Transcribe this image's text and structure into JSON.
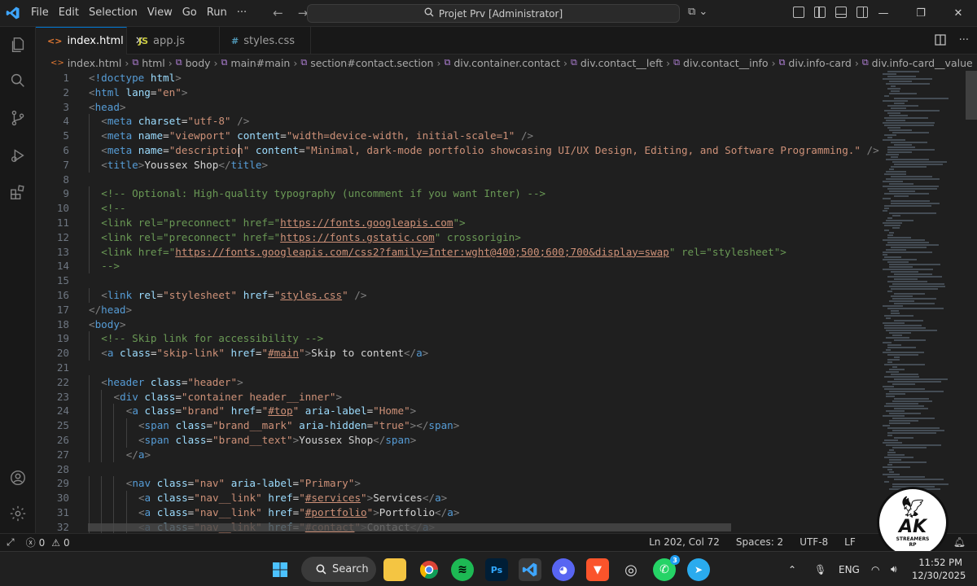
{
  "titlebar": {
    "menu": [
      "File",
      "Edit",
      "Selection",
      "View",
      "Go",
      "Run",
      "···"
    ],
    "command_center": "Projet Prv [Administrator]"
  },
  "tabs": [
    {
      "label": "index.html",
      "icon": "html-icon",
      "active": true
    },
    {
      "label": "app.js",
      "icon": "js-icon",
      "active": false
    },
    {
      "label": "styles.css",
      "icon": "css-icon",
      "active": false
    }
  ],
  "breadcrumb": [
    "index.html",
    "html",
    "body",
    "main#main",
    "section#contact.section",
    "div.container.contact",
    "div.contact__left",
    "div.contact__info",
    "div.info-card",
    "div.info-card__value"
  ],
  "editor": {
    "lines": [
      {
        "n": "1",
        "indent": 0,
        "tokens": [
          [
            "punc",
            "<"
          ],
          [
            "tag",
            "!doctype"
          ],
          [
            "txt",
            " "
          ],
          [
            "attr",
            "html"
          ],
          [
            "punc",
            ">"
          ]
        ]
      },
      {
        "n": "2",
        "indent": 0,
        "tokens": [
          [
            "punc",
            "<"
          ],
          [
            "tag",
            "html"
          ],
          [
            "txt",
            " "
          ],
          [
            "attr",
            "lang"
          ],
          [
            "txt",
            "="
          ],
          [
            "str",
            "\"en\""
          ],
          [
            "punc",
            ">"
          ]
        ]
      },
      {
        "n": "3",
        "indent": 0,
        "tokens": [
          [
            "punc",
            "<"
          ],
          [
            "tag",
            "head"
          ],
          [
            "punc",
            ">"
          ]
        ]
      },
      {
        "n": "4",
        "indent": 1,
        "tokens": [
          [
            "punc",
            "<"
          ],
          [
            "tag",
            "meta"
          ],
          [
            "txt",
            " "
          ],
          [
            "attr",
            "charset"
          ],
          [
            "txt",
            "="
          ],
          [
            "str",
            "\"utf-8\""
          ],
          [
            "txt",
            " "
          ],
          [
            "punc",
            "/>"
          ]
        ]
      },
      {
        "n": "5",
        "indent": 1,
        "tokens": [
          [
            "punc",
            "<"
          ],
          [
            "tag",
            "meta"
          ],
          [
            "txt",
            " "
          ],
          [
            "attr",
            "name"
          ],
          [
            "txt",
            "="
          ],
          [
            "str",
            "\"viewport\""
          ],
          [
            "txt",
            " "
          ],
          [
            "attr",
            "content"
          ],
          [
            "txt",
            "="
          ],
          [
            "str",
            "\"width=device-width, initial-scale=1\""
          ],
          [
            "txt",
            " "
          ],
          [
            "punc",
            "/>"
          ]
        ]
      },
      {
        "n": "6",
        "indent": 1,
        "tokens": [
          [
            "punc",
            "<"
          ],
          [
            "tag",
            "meta"
          ],
          [
            "txt",
            " "
          ],
          [
            "attr",
            "name"
          ],
          [
            "txt",
            "="
          ],
          [
            "str",
            "\"description\""
          ],
          [
            "txt",
            " "
          ],
          [
            "attr",
            "content"
          ],
          [
            "txt",
            "="
          ],
          [
            "str",
            "\"Minimal, dark-mode portfolio showcasing UI/UX Design, Editing, and Software Programming.\""
          ],
          [
            "txt",
            " "
          ],
          [
            "punc",
            "/>"
          ]
        ]
      },
      {
        "n": "7",
        "indent": 1,
        "tokens": [
          [
            "punc",
            "<"
          ],
          [
            "tag",
            "title"
          ],
          [
            "punc",
            ">"
          ],
          [
            "txt",
            "Youssex Shop"
          ],
          [
            "punc",
            "</"
          ],
          [
            "tag",
            "title"
          ],
          [
            "punc",
            ">"
          ]
        ]
      },
      {
        "n": "8",
        "indent": 0,
        "tokens": []
      },
      {
        "n": "9",
        "indent": 1,
        "tokens": [
          [
            "cmt",
            "<!-- Optional: High-quality typography (uncomment if you want Inter) -->"
          ]
        ]
      },
      {
        "n": "10",
        "indent": 1,
        "tokens": [
          [
            "cmt",
            "<!--"
          ]
        ]
      },
      {
        "n": "11",
        "indent": 1,
        "tokens": [
          [
            "cmt",
            "<link rel=\"preconnect\" href=\""
          ],
          [
            "url",
            "https://fonts.googleapis.com"
          ],
          [
            "cmt",
            "\">"
          ]
        ]
      },
      {
        "n": "12",
        "indent": 1,
        "tokens": [
          [
            "cmt",
            "<link rel=\"preconnect\" href=\""
          ],
          [
            "url",
            "https://fonts.gstatic.com"
          ],
          [
            "cmt",
            "\" crossorigin>"
          ]
        ]
      },
      {
        "n": "13",
        "indent": 1,
        "tokens": [
          [
            "cmt",
            "<link href=\""
          ],
          [
            "url",
            "https://fonts.googleapis.com/css2?family=Inter:wght@400;500;600;700&display=swap"
          ],
          [
            "cmt",
            "\" rel=\"stylesheet\">"
          ]
        ]
      },
      {
        "n": "14",
        "indent": 1,
        "tokens": [
          [
            "cmt",
            "-->"
          ]
        ]
      },
      {
        "n": "15",
        "indent": 0,
        "tokens": []
      },
      {
        "n": "16",
        "indent": 1,
        "tokens": [
          [
            "punc",
            "<"
          ],
          [
            "tag",
            "link"
          ],
          [
            "txt",
            " "
          ],
          [
            "attr",
            "rel"
          ],
          [
            "txt",
            "="
          ],
          [
            "str",
            "\"stylesheet\""
          ],
          [
            "txt",
            " "
          ],
          [
            "attr",
            "href"
          ],
          [
            "txt",
            "="
          ],
          [
            "str",
            "\""
          ],
          [
            "url",
            "styles.css"
          ],
          [
            "str",
            "\""
          ],
          [
            "txt",
            " "
          ],
          [
            "punc",
            "/>"
          ]
        ]
      },
      {
        "n": "17",
        "indent": 0,
        "tokens": [
          [
            "punc",
            "</"
          ],
          [
            "tag",
            "head"
          ],
          [
            "punc",
            ">"
          ]
        ]
      },
      {
        "n": "18",
        "indent": 0,
        "tokens": [
          [
            "punc",
            "<"
          ],
          [
            "tag",
            "body"
          ],
          [
            "punc",
            ">"
          ]
        ]
      },
      {
        "n": "19",
        "indent": 1,
        "tokens": [
          [
            "cmt",
            "<!-- Skip link for accessibility -->"
          ]
        ]
      },
      {
        "n": "20",
        "indent": 1,
        "tokens": [
          [
            "punc",
            "<"
          ],
          [
            "tag",
            "a"
          ],
          [
            "txt",
            " "
          ],
          [
            "attr",
            "class"
          ],
          [
            "txt",
            "="
          ],
          [
            "str",
            "\"skip-link\""
          ],
          [
            "txt",
            " "
          ],
          [
            "attr",
            "href"
          ],
          [
            "txt",
            "="
          ],
          [
            "str",
            "\""
          ],
          [
            "url",
            "#main"
          ],
          [
            "str",
            "\""
          ],
          [
            "punc",
            ">"
          ],
          [
            "txt",
            "Skip to content"
          ],
          [
            "punc",
            "</"
          ],
          [
            "tag",
            "a"
          ],
          [
            "punc",
            ">"
          ]
        ]
      },
      {
        "n": "21",
        "indent": 0,
        "tokens": []
      },
      {
        "n": "22",
        "indent": 1,
        "tokens": [
          [
            "punc",
            "<"
          ],
          [
            "tag",
            "header"
          ],
          [
            "txt",
            " "
          ],
          [
            "attr",
            "class"
          ],
          [
            "txt",
            "="
          ],
          [
            "str",
            "\"header\""
          ],
          [
            "punc",
            ">"
          ]
        ]
      },
      {
        "n": "23",
        "indent": 2,
        "tokens": [
          [
            "punc",
            "<"
          ],
          [
            "tag",
            "div"
          ],
          [
            "txt",
            " "
          ],
          [
            "attr",
            "class"
          ],
          [
            "txt",
            "="
          ],
          [
            "str",
            "\"container header__inner\""
          ],
          [
            "punc",
            ">"
          ]
        ]
      },
      {
        "n": "24",
        "indent": 3,
        "tokens": [
          [
            "punc",
            "<"
          ],
          [
            "tag",
            "a"
          ],
          [
            "txt",
            " "
          ],
          [
            "attr",
            "class"
          ],
          [
            "txt",
            "="
          ],
          [
            "str",
            "\"brand\""
          ],
          [
            "txt",
            " "
          ],
          [
            "attr",
            "href"
          ],
          [
            "txt",
            "="
          ],
          [
            "str",
            "\""
          ],
          [
            "url",
            "#top"
          ],
          [
            "str",
            "\""
          ],
          [
            "txt",
            " "
          ],
          [
            "attr",
            "aria-label"
          ],
          [
            "txt",
            "="
          ],
          [
            "str",
            "\"Home\""
          ],
          [
            "punc",
            ">"
          ]
        ]
      },
      {
        "n": "25",
        "indent": 4,
        "tokens": [
          [
            "punc",
            "<"
          ],
          [
            "tag",
            "span"
          ],
          [
            "txt",
            " "
          ],
          [
            "attr",
            "class"
          ],
          [
            "txt",
            "="
          ],
          [
            "str",
            "\"brand__mark\""
          ],
          [
            "txt",
            " "
          ],
          [
            "attr",
            "aria-hidden"
          ],
          [
            "txt",
            "="
          ],
          [
            "str",
            "\"true\""
          ],
          [
            "punc",
            "></"
          ],
          [
            "tag",
            "span"
          ],
          [
            "punc",
            ">"
          ]
        ]
      },
      {
        "n": "26",
        "indent": 4,
        "tokens": [
          [
            "punc",
            "<"
          ],
          [
            "tag",
            "span"
          ],
          [
            "txt",
            " "
          ],
          [
            "attr",
            "class"
          ],
          [
            "txt",
            "="
          ],
          [
            "str",
            "\"brand__text\""
          ],
          [
            "punc",
            ">"
          ],
          [
            "txt",
            "Youssex Shop"
          ],
          [
            "punc",
            "</"
          ],
          [
            "tag",
            "span"
          ],
          [
            "punc",
            ">"
          ]
        ]
      },
      {
        "n": "27",
        "indent": 3,
        "tokens": [
          [
            "punc",
            "</"
          ],
          [
            "tag",
            "a"
          ],
          [
            "punc",
            ">"
          ]
        ]
      },
      {
        "n": "28",
        "indent": 0,
        "tokens": []
      },
      {
        "n": "29",
        "indent": 3,
        "tokens": [
          [
            "punc",
            "<"
          ],
          [
            "tag",
            "nav"
          ],
          [
            "txt",
            " "
          ],
          [
            "attr",
            "class"
          ],
          [
            "txt",
            "="
          ],
          [
            "str",
            "\"nav\""
          ],
          [
            "txt",
            " "
          ],
          [
            "attr",
            "aria-label"
          ],
          [
            "txt",
            "="
          ],
          [
            "str",
            "\"Primary\""
          ],
          [
            "punc",
            ">"
          ]
        ]
      },
      {
        "n": "30",
        "indent": 4,
        "tokens": [
          [
            "punc",
            "<"
          ],
          [
            "tag",
            "a"
          ],
          [
            "txt",
            " "
          ],
          [
            "attr",
            "class"
          ],
          [
            "txt",
            "="
          ],
          [
            "str",
            "\"nav__link\""
          ],
          [
            "txt",
            " "
          ],
          [
            "attr",
            "href"
          ],
          [
            "txt",
            "="
          ],
          [
            "str",
            "\""
          ],
          [
            "url",
            "#services"
          ],
          [
            "str",
            "\""
          ],
          [
            "punc",
            ">"
          ],
          [
            "txt",
            "Services"
          ],
          [
            "punc",
            "</"
          ],
          [
            "tag",
            "a"
          ],
          [
            "punc",
            ">"
          ]
        ]
      },
      {
        "n": "31",
        "indent": 4,
        "tokens": [
          [
            "punc",
            "<"
          ],
          [
            "tag",
            "a"
          ],
          [
            "txt",
            " "
          ],
          [
            "attr",
            "class"
          ],
          [
            "txt",
            "="
          ],
          [
            "str",
            "\"nav__link\""
          ],
          [
            "txt",
            " "
          ],
          [
            "attr",
            "href"
          ],
          [
            "txt",
            "="
          ],
          [
            "str",
            "\""
          ],
          [
            "url",
            "#portfolio"
          ],
          [
            "str",
            "\""
          ],
          [
            "punc",
            ">"
          ],
          [
            "txt",
            "Portfolio"
          ],
          [
            "punc",
            "</"
          ],
          [
            "tag",
            "a"
          ],
          [
            "punc",
            ">"
          ]
        ]
      },
      {
        "n": "32",
        "indent": 4,
        "tokens": [
          [
            "punc",
            "<"
          ],
          [
            "tag",
            "a"
          ],
          [
            "txt",
            " "
          ],
          [
            "attr",
            "class"
          ],
          [
            "txt",
            "="
          ],
          [
            "str",
            "\"nav__link\""
          ],
          [
            "txt",
            " "
          ],
          [
            "attr",
            "href"
          ],
          [
            "txt",
            "="
          ],
          [
            "str",
            "\""
          ],
          [
            "url",
            "#contact"
          ],
          [
            "str",
            "\""
          ],
          [
            "punc",
            ">"
          ],
          [
            "txt",
            "Contact"
          ],
          [
            "punc",
            "</"
          ],
          [
            "tag",
            "a"
          ],
          [
            "punc",
            ">"
          ]
        ]
      }
    ]
  },
  "statusbar": {
    "errors": "0",
    "warnings": "0",
    "position": "Ln 202, Col 72",
    "spaces": "Spaces: 2",
    "encoding": "UTF-8",
    "eol": "LF"
  },
  "watermark": {
    "big": "AK",
    "small": "STREAMERS",
    "sub": "RP"
  },
  "taskbar": {
    "search_label": "Search",
    "language": "ENG",
    "time": "11:52 PM",
    "date": "12/30/2025",
    "telegram_badge": "3"
  },
  "colors": {
    "accent": "#0078d4",
    "editor_bg": "#1f1f1f",
    "tag": "#569cd6",
    "attr": "#9cdcfe",
    "string": "#ce9178",
    "comment": "#6a9955"
  }
}
